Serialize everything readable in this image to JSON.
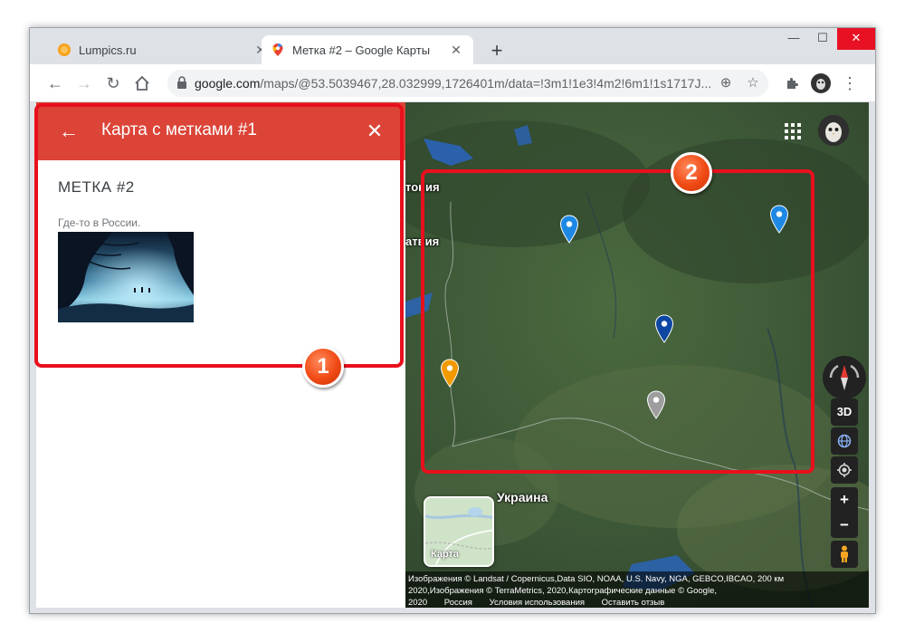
{
  "browser": {
    "tabs": [
      {
        "title": "Lumpics.ru",
        "active": false,
        "favicon": "orange-circle-icon"
      },
      {
        "title": "Метка #2 – Google Карты",
        "active": true,
        "favicon": "google-maps-pin-icon"
      }
    ],
    "new_tab_symbol": "+",
    "url_domain": "google.com",
    "url_rest": "/maps/@53.5039467,28.032999,1726401m/data=!3m1!1e3!4m2!6m1!1s1717J...",
    "window_controls": {
      "minimize": "—",
      "maximize": "☐",
      "close": "✕"
    }
  },
  "panel": {
    "title": "Карта с метками #1",
    "back_symbol": "←",
    "close_symbol": "✕",
    "mark_title": "МЕТКА #2",
    "description": "Где-то в России."
  },
  "map": {
    "labels": {
      "estonia": "тония",
      "latvia": "атвия",
      "ukraine": "Украина"
    },
    "layer_label": "Карта",
    "controls": {
      "three_d": "3D",
      "zoom_in": "+",
      "zoom_out": "−"
    },
    "footer": {
      "line1": "Изображения © Landsat / Copernicus,Data SIO, NOAA, U.S. Navy, NGA, GEBCO,IBCAO, 200 км",
      "line2": "2020,Изображения © TerraMetrics, 2020,Картографические данные © Google,",
      "year": "2020",
      "country": "Россия",
      "terms": "Условия использования",
      "feedback": "Оставить отзыв"
    },
    "pins": [
      {
        "name": "pin-light-blue-1",
        "color": "#1e88e5"
      },
      {
        "name": "pin-light-blue-2",
        "color": "#1e88e5"
      },
      {
        "name": "pin-dark-blue",
        "color": "#0d47a1"
      },
      {
        "name": "pin-orange",
        "color": "#f29900"
      },
      {
        "name": "pin-gray",
        "color": "#9e9e9e"
      }
    ]
  },
  "callouts": {
    "one": "1",
    "two": "2"
  },
  "colors": {
    "panel_header": "#db4437",
    "callout": "#e8101d"
  }
}
